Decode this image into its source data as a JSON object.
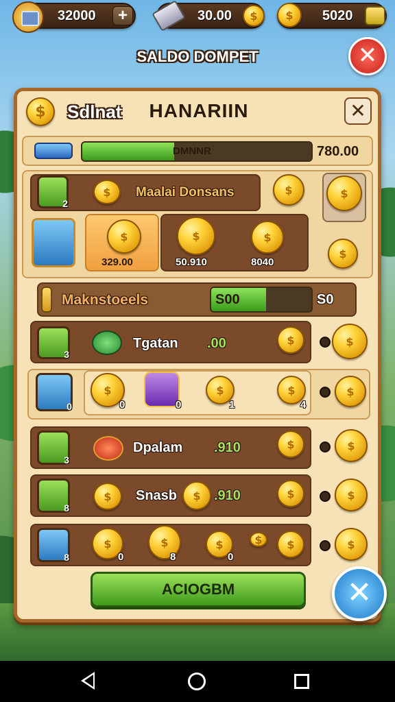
{
  "topbar": {
    "chest_value": "32000",
    "plus_label": "+",
    "bar_value": "30.00",
    "coin_value": "5020"
  },
  "header": {
    "title": "SALDO DOMPET",
    "close_label": "✕"
  },
  "panel": {
    "label": "Sdlnat",
    "title": "HANARIIN",
    "close_label": "✕",
    "progress_text": "DMNNR",
    "progress_value": "780.00",
    "progress_fraction": 0.4,
    "featured_label": "Maalai Donsans",
    "featured_num": "2",
    "featured_items": [
      {
        "value": "329.00"
      },
      {
        "value": "50.910"
      },
      {
        "value": "8040"
      }
    ],
    "mid_label": "Maknstoeels",
    "mid_bar_text": "S00",
    "mid_bar_fraction": 0.55,
    "mid_value": "S0",
    "rows": [
      {
        "name": "Tgatan",
        "value": ".00",
        "num": "3"
      },
      {
        "num": "0",
        "items": [
          "0",
          "0",
          "1",
          "4"
        ]
      },
      {
        "name": "Dpalam",
        "value": ".910",
        "num": "3"
      },
      {
        "name": "Snasb",
        "value": ".910",
        "num": "8"
      },
      {
        "num": "8",
        "items": [
          "0",
          "8",
          "0"
        ]
      }
    ],
    "confirm_label": "ACIOGBM"
  },
  "colors": {
    "panel_bg": "#f6e2b6",
    "panel_border": "#a8682c",
    "confirm_green": "#6cc03a",
    "close_red": "#e23a2a",
    "close_blue": "#2d8ed9"
  },
  "icons": [
    "chest-icon",
    "silver-bar-icon",
    "gold-coin-icon",
    "plus-icon",
    "close-icon",
    "nav-back-icon",
    "nav-home-icon",
    "nav-recent-icon"
  ]
}
